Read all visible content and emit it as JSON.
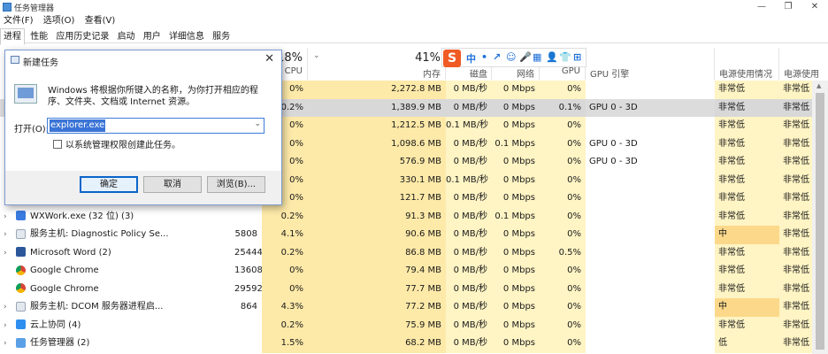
{
  "window": {
    "title": "任务管理器",
    "controls": [
      "—",
      "❐",
      "✕"
    ]
  },
  "menu": [
    "文件(F)",
    "选项(O)",
    "查看(V)"
  ],
  "tabs": [
    "进程",
    "性能",
    "应用历史记录",
    "启动",
    "用户",
    "详细信息",
    "服务"
  ],
  "columns": {
    "cpu": {
      "pct": "18%",
      "label": "CPU"
    },
    "memory": {
      "pct": "41%",
      "label": "内存"
    },
    "disk": {
      "label": "磁盘"
    },
    "network": {
      "label": "网络"
    },
    "gpu": {
      "label": "GPU"
    },
    "gpu_engine": {
      "label": "GPU 引擎"
    },
    "power": {
      "label": "电源使用情况"
    },
    "power_trend": {
      "label": "电源使用"
    }
  },
  "ime_toolbar": {
    "logo": "S",
    "keys": [
      "中",
      "•",
      "↗",
      "☺",
      "🎤",
      "▦",
      "👤",
      "👕",
      "⊞"
    ]
  },
  "rows": [
    {
      "name": "",
      "pid": "",
      "cpu": "0%",
      "mem": "2,272.8 MB",
      "disk": "0 MB/秒",
      "net": "0 Mbps",
      "gpu": "0%",
      "engine": "",
      "power": "非常低",
      "trend": "非常低"
    },
    {
      "name": "",
      "pid": "",
      "cpu": "0.2%",
      "mem": "1,389.9 MB",
      "disk": "0 MB/秒",
      "net": "0 Mbps",
      "gpu": "0.1%",
      "engine": "GPU 0 - 3D",
      "power": "非常低",
      "trend": "非常低",
      "selected": true
    },
    {
      "name": "",
      "pid": "",
      "cpu": "0%",
      "mem": "1,212.5 MB",
      "disk": "0.1 MB/秒",
      "net": "0 Mbps",
      "gpu": "0%",
      "engine": "",
      "power": "非常低",
      "trend": "非常低"
    },
    {
      "name": "",
      "pid": "",
      "cpu": "0%",
      "mem": "1,098.6 MB",
      "disk": "0 MB/秒",
      "net": "0.1 Mbps",
      "gpu": "0%",
      "engine": "GPU 0 - 3D",
      "power": "非常低",
      "trend": "非常低"
    },
    {
      "name": "",
      "pid": "",
      "cpu": "0%",
      "mem": "576.9 MB",
      "disk": "0 MB/秒",
      "net": "0 Mbps",
      "gpu": "0%",
      "engine": "GPU 0 - 3D",
      "power": "非常低",
      "trend": "非常低"
    },
    {
      "name": "",
      "pid": "",
      "cpu": "0%",
      "mem": "330.1 MB",
      "disk": "0.1 MB/秒",
      "net": "0 Mbps",
      "gpu": "0%",
      "engine": "",
      "power": "非常低",
      "trend": "非常低"
    },
    {
      "name": "",
      "pid": "",
      "cpu": "0%",
      "mem": "121.7 MB",
      "disk": "0 MB/秒",
      "net": "0 Mbps",
      "gpu": "0%",
      "engine": "",
      "power": "非常低",
      "trend": "非常低"
    },
    {
      "name": "WXWork.exe (32 位) (3)",
      "pid": "",
      "icon": "wx",
      "expand": true,
      "cpu": "0.2%",
      "mem": "91.3 MB",
      "disk": "0 MB/秒",
      "net": "0.1 Mbps",
      "gpu": "0%",
      "engine": "",
      "power": "非常低",
      "trend": "非常低"
    },
    {
      "name": "服务主机: Diagnostic Policy Se...",
      "pid": "5808",
      "icon": "svc",
      "expand": true,
      "cpu": "4.1%",
      "mem": "90.6 MB",
      "disk": "0 MB/秒",
      "net": "0 Mbps",
      "gpu": "0%",
      "engine": "",
      "power": "中",
      "trend": "非常低",
      "powerHigh": true
    },
    {
      "name": "Microsoft Word (2)",
      "pid": "25444",
      "icon": "word",
      "expand": true,
      "cpu": "0.2%",
      "mem": "86.8 MB",
      "disk": "0 MB/秒",
      "net": "0 Mbps",
      "gpu": "0.5%",
      "engine": "",
      "power": "非常低",
      "trend": "非常低"
    },
    {
      "name": "Google Chrome",
      "pid": "13608",
      "icon": "chrome",
      "expand": false,
      "cpu": "0%",
      "mem": "79.4 MB",
      "disk": "0 MB/秒",
      "net": "0 Mbps",
      "gpu": "0%",
      "engine": "",
      "power": "非常低",
      "trend": "非常低"
    },
    {
      "name": "Google Chrome",
      "pid": "29592",
      "icon": "chrome",
      "expand": false,
      "cpu": "0%",
      "mem": "77.7 MB",
      "disk": "0 MB/秒",
      "net": "0 Mbps",
      "gpu": "0%",
      "engine": "",
      "power": "非常低",
      "trend": "非常低"
    },
    {
      "name": "服务主机: DCOM 服务器进程启...",
      "pid": "864",
      "icon": "svc",
      "expand": true,
      "cpu": "4.3%",
      "mem": "77.2 MB",
      "disk": "0 MB/秒",
      "net": "0 Mbps",
      "gpu": "0%",
      "engine": "",
      "power": "中",
      "trend": "非常低",
      "powerHigh": true
    },
    {
      "name": "云上协同 (4)",
      "pid": "",
      "icon": "cloud",
      "expand": true,
      "cpu": "0.2%",
      "mem": "75.9 MB",
      "disk": "0 MB/秒",
      "net": "0 Mbps",
      "gpu": "0%",
      "engine": "",
      "power": "非常低",
      "trend": "非常低"
    },
    {
      "name": "任务管理器 (2)",
      "pid": "",
      "icon": "tm",
      "expand": true,
      "cpu": "1.5%",
      "mem": "68.2 MB",
      "disk": "0 MB/秒",
      "net": "0 Mbps",
      "gpu": "0%",
      "engine": "",
      "power": "低",
      "trend": "非常低"
    }
  ],
  "dialog": {
    "title": "新建任务",
    "close": "✕",
    "description": "Windows 将根据你所键入的名称，为你打开相应的程序、文件夹、文档或 Internet 资源。",
    "open_label": "打开(O):",
    "open_value": "explorer.exe",
    "admin_label": "以系统管理权限创建此任务。",
    "ok": "确定",
    "cancel": "取消",
    "browse": "浏览(B)..."
  }
}
